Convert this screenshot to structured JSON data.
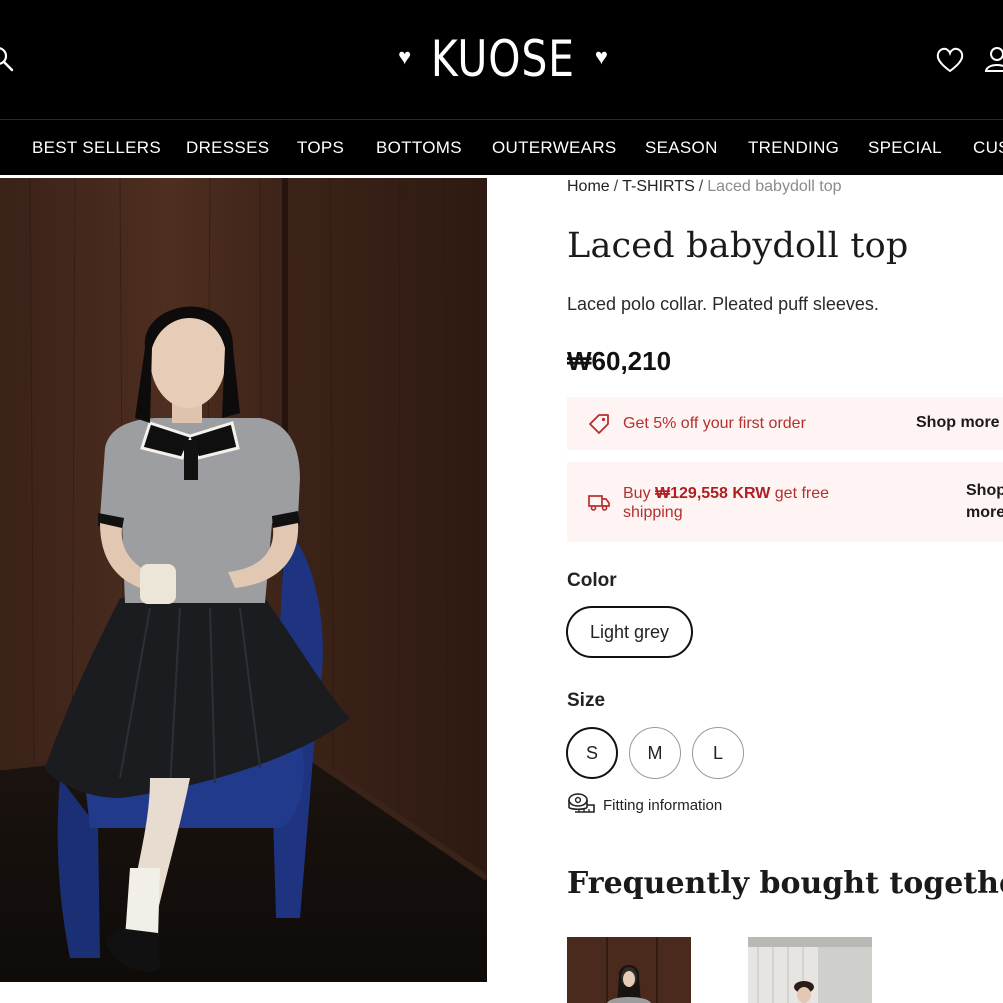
{
  "header": {
    "logo": "KUOSE",
    "logo_heart": "♥"
  },
  "nav": {
    "items": [
      "BEST SELLERS",
      "DRESSES",
      "TOPS",
      "BOTTOMS",
      "OUTERWEARS",
      "SEASON",
      "TRENDING",
      "SPECIAL",
      "CUS"
    ]
  },
  "breadcrumb": {
    "home": "Home",
    "category": "T-SHIRTS",
    "current": "Laced babydoll top",
    "separator": "/"
  },
  "product": {
    "title": "Laced babydoll top",
    "subtitle": "Laced polo collar. Pleated puff sleeves.",
    "price": "₩60,210"
  },
  "promos": {
    "first_order": {
      "text": "Get 5% off your first order",
      "link": "Shop more",
      "icon": "tag-icon"
    },
    "shipping": {
      "text_before": "Buy ",
      "amount": "₩129,558 KRW",
      "text_after": " get free shipping",
      "link_line1": "Shop",
      "link_line2": "more",
      "icon": "delivery-truck-icon"
    }
  },
  "options": {
    "color_label": "Color",
    "color_selected": "Light grey",
    "size_label": "Size",
    "sizes": [
      "S",
      "M",
      "L"
    ],
    "size_selected": "S",
    "fitting_label": "Fitting information"
  },
  "related": {
    "title": "Frequently bought together:"
  },
  "colors": {
    "header_bg": "#000000",
    "promo_bg": "#fdf4f3",
    "promo_text": "#b5302e"
  }
}
